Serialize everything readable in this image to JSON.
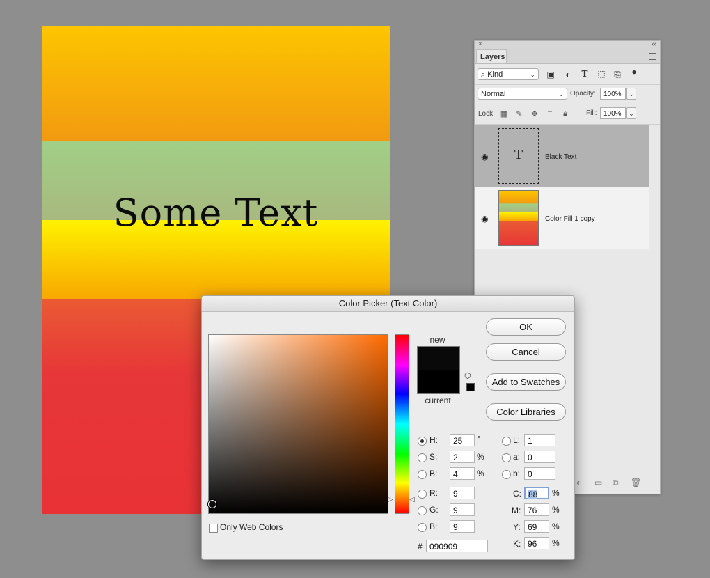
{
  "canvas": {
    "text": "Some Text"
  },
  "layers_panel": {
    "close_glyph": "×",
    "collapse_glyph": "‹‹",
    "tab_label": "Layers",
    "filter_kind": "Kind",
    "blend_mode": "Normal",
    "opacity_label": "Opacity:",
    "opacity_value": "100%",
    "lock_label": "Lock:",
    "fill_label": "Fill:",
    "fill_value": "100%",
    "layers": [
      {
        "name": "Black Text",
        "thumb_glyph": "T",
        "selected": true
      },
      {
        "name": "Color Fill 1 copy",
        "selected": false
      }
    ]
  },
  "color_picker": {
    "title": "Color Picker (Text Color)",
    "label_new": "new",
    "label_current": "current",
    "new_color": "#090909",
    "current_color": "#000000",
    "buttons": {
      "ok": "OK",
      "cancel": "Cancel",
      "add_swatches": "Add to Swatches",
      "libraries": "Color Libraries"
    },
    "hsb": {
      "h_label": "H:",
      "h_value": "25",
      "h_unit": "°",
      "s_label": "S:",
      "s_value": "2",
      "s_unit": "%",
      "b_label": "B:",
      "b_value": "4",
      "b_unit": "%"
    },
    "rgb": {
      "r_label": "R:",
      "r_value": "9",
      "g_label": "G:",
      "g_value": "9",
      "b_label": "B:",
      "b_value": "9"
    },
    "lab": {
      "l_label": "L:",
      "l_value": "1",
      "a_label": "a:",
      "a_value": "0",
      "b_label": "b:",
      "b_value": "0"
    },
    "cmyk": {
      "c_label": "C:",
      "c_value": "88",
      "m_label": "M:",
      "m_value": "76",
      "y_label": "Y:",
      "y_value": "69",
      "k_label": "K:",
      "k_value": "96",
      "unit": "%"
    },
    "hex_label": "#",
    "hex_value": "090909",
    "only_web_colors": "Only Web Colors"
  }
}
